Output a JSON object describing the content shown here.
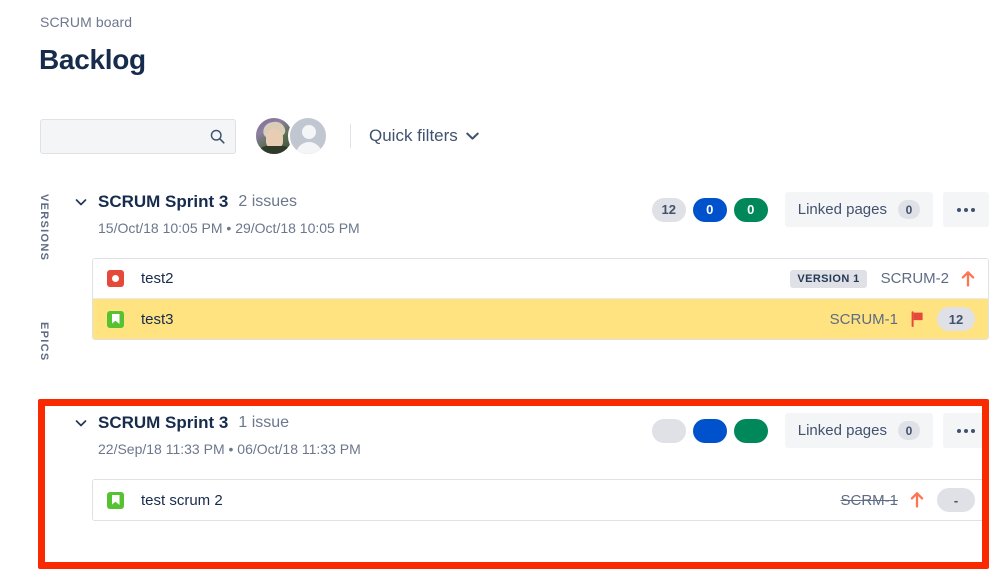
{
  "header": {
    "breadcrumb": "SCRUM board",
    "title": "Backlog"
  },
  "toolbar": {
    "search_placeholder": "",
    "search_value": "",
    "search_icon": "search-icon",
    "quick_filters_label": "Quick filters",
    "chevron_icon": "chevron-down-icon",
    "avatars": [
      {
        "name": "user-avatar-photo",
        "type": "photo"
      },
      {
        "name": "user-avatar-default",
        "type": "default"
      }
    ]
  },
  "rail": {
    "versions_label": "VERSIONS",
    "epics_label": "EPICS"
  },
  "sprints": [
    {
      "name": "SCRUM Sprint 3",
      "issue_count_label": "2 issues",
      "dates": "15/Oct/18 10:05 PM  •  29/Oct/18 10:05 PM",
      "start_date": "15/Oct/18 10:05 PM",
      "end_date": "29/Oct/18 10:05 PM",
      "pills": [
        {
          "value": "12",
          "color": "#dfe1e6",
          "style": "grey"
        },
        {
          "value": "0",
          "color": "#0052cc",
          "style": "blue"
        },
        {
          "value": "0",
          "color": "#00875a",
          "style": "green"
        }
      ],
      "linked_pages_label": "Linked pages",
      "linked_pages_count": "0",
      "more_label": "•••",
      "issues": [
        {
          "type": "bug",
          "title": "test2",
          "version_tag": "VERSION 1",
          "key": "SCRUM-2",
          "key_done": false,
          "priority": "up-arrow",
          "estimate": "",
          "highlighted": false
        },
        {
          "type": "story",
          "title": "test3",
          "version_tag": "",
          "key": "SCRUM-1",
          "key_done": false,
          "priority": "flag",
          "estimate": "12",
          "highlighted": true
        }
      ]
    },
    {
      "name": "SCRUM Sprint 3",
      "issue_count_label": "1 issue",
      "dates": "22/Sep/18 11:33 PM  •  06/Oct/18 11:33 PM",
      "start_date": "22/Sep/18 11:33 PM",
      "end_date": "06/Oct/18 11:33 PM",
      "pills": [
        {
          "value": "",
          "color": "#dfe1e6",
          "style": "grey empty"
        },
        {
          "value": "",
          "color": "#0052cc",
          "style": "blue empty"
        },
        {
          "value": "",
          "color": "#00875a",
          "style": "green empty"
        }
      ],
      "linked_pages_label": "Linked pages",
      "linked_pages_count": "0",
      "more_label": "•••",
      "issues": [
        {
          "type": "story",
          "title": "test scrum 2",
          "version_tag": "",
          "key": "SCRM-1",
          "key_done": true,
          "priority": "up-arrow",
          "estimate": "-",
          "highlighted": false
        }
      ]
    }
  ],
  "annotation": {
    "name": "red-highlight-box",
    "color": "#fa2a00"
  }
}
